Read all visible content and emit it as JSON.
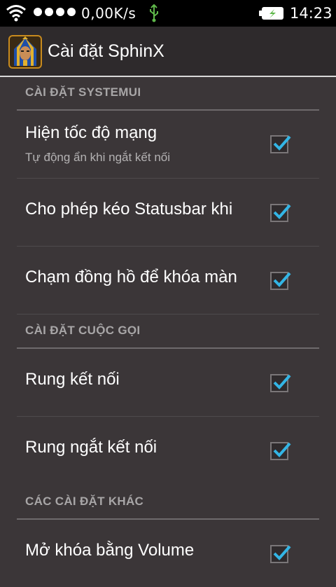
{
  "status_bar": {
    "network_speed": "0,00K/s",
    "time": "14:23",
    "icons": [
      "wifi-icon",
      "signal-dots-icon",
      "usb-icon",
      "battery-charging-icon"
    ]
  },
  "action_bar": {
    "title": "Cài đặt SphinX",
    "icon": "pharaoh-app-icon"
  },
  "sections": [
    {
      "header": "CÀI ĐẶT SYSTEMUI",
      "items": [
        {
          "title": "Hiện tốc độ mạng",
          "summary": "Tự động ẩn khi ngắt kết nối",
          "checked": true
        },
        {
          "title": "Cho phép kéo Statusbar khi",
          "summary": "",
          "checked": true
        },
        {
          "title": "Chạm đồng hồ để khóa màn",
          "summary": "",
          "checked": true
        }
      ]
    },
    {
      "header": "CÀI ĐẶT CUỘC GỌI",
      "items": [
        {
          "title": "Rung kết nối",
          "summary": "",
          "checked": true
        },
        {
          "title": "Rung ngắt kết nối",
          "summary": "",
          "checked": true
        }
      ]
    },
    {
      "header": "CÁC CÀI ĐẶT KHÁC",
      "items": [
        {
          "title": "Mở khóa bằng Volume",
          "summary": "",
          "checked": true
        }
      ]
    }
  ],
  "colors": {
    "background": "#3b3638",
    "action_bar": "#2e2a2c",
    "status_bar": "#000000",
    "check_accent": "#33b5e5",
    "section_header_text": "#a8a6a7"
  }
}
